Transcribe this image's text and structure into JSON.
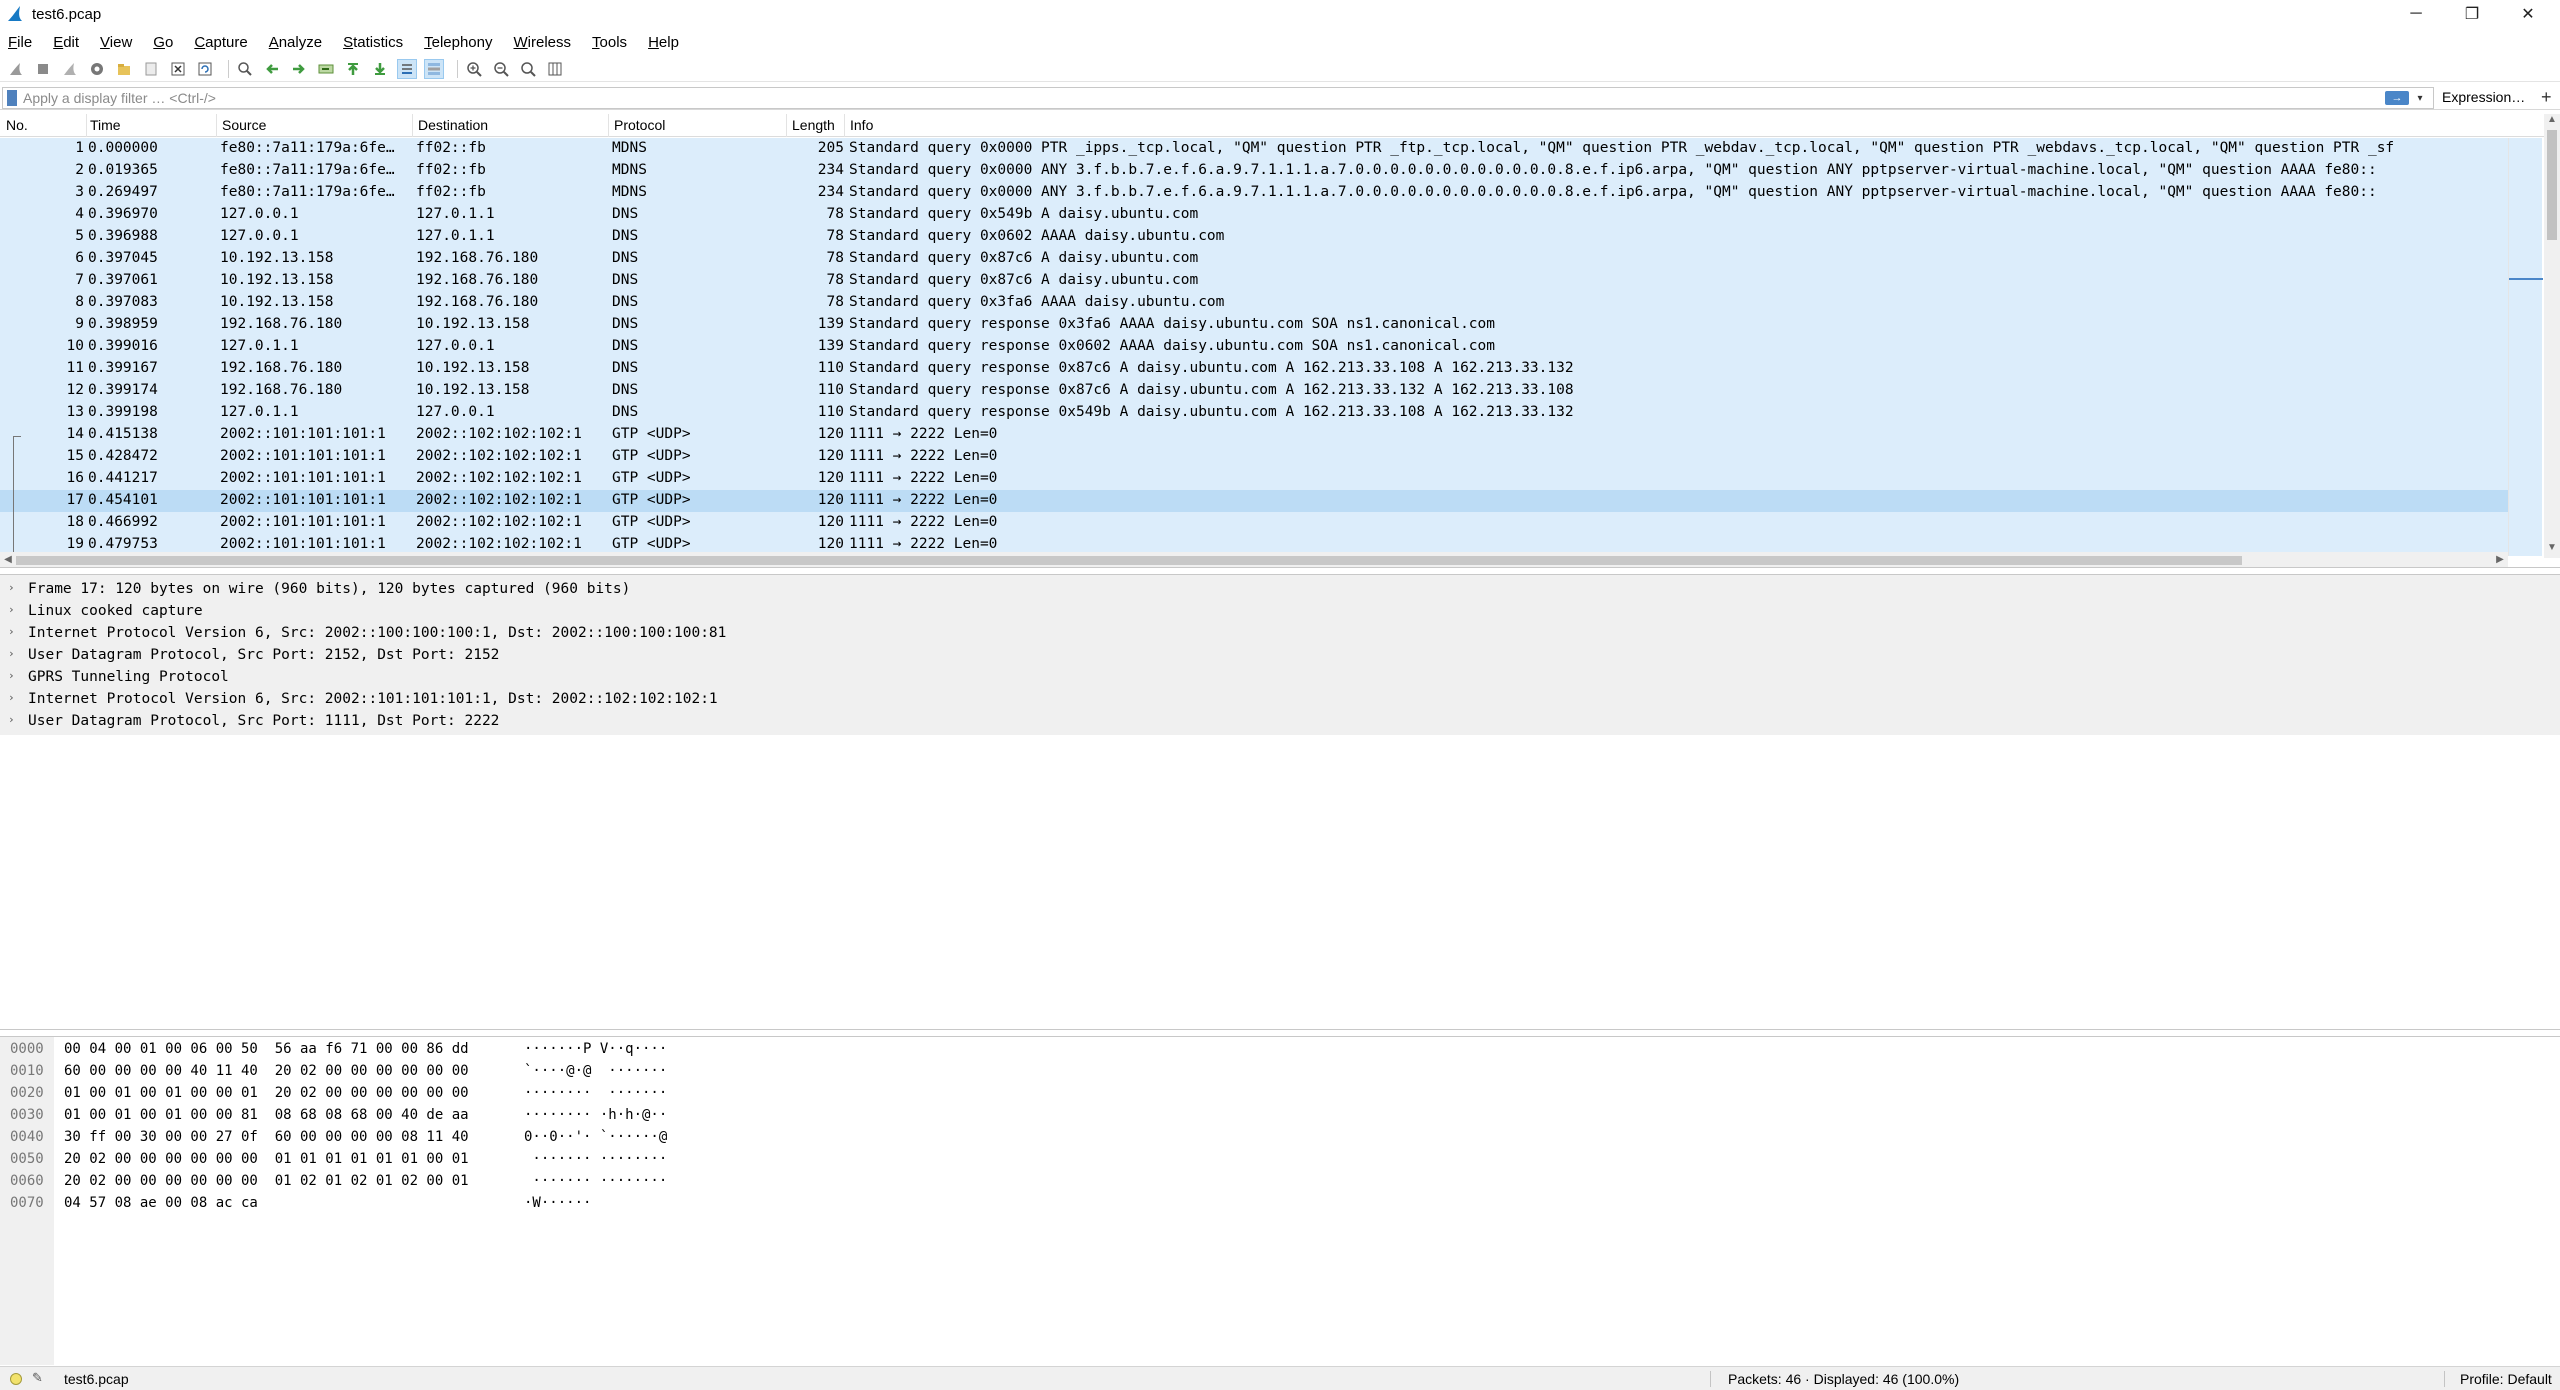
{
  "window": {
    "title": "test6.pcap",
    "controls": [
      "─",
      "❐",
      "✕"
    ]
  },
  "menu": [
    "File",
    "Edit",
    "View",
    "Go",
    "Capture",
    "Analyze",
    "Statistics",
    "Telephony",
    "Wireless",
    "Tools",
    "Help"
  ],
  "filter": {
    "placeholder": "Apply a display filter … <Ctrl-/>",
    "expression_label": "Expression…",
    "plus_label": "+"
  },
  "columns": {
    "no": "No.",
    "time": "Time",
    "source": "Source",
    "destination": "Destination",
    "protocol": "Protocol",
    "length": "Length",
    "info": "Info"
  },
  "packets": [
    {
      "no": "1",
      "time": "0.000000",
      "src": "fe80::7a11:179a:6fe…",
      "dst": "ff02::fb",
      "proto": "MDNS",
      "len": "205",
      "info": "Standard query 0x0000 PTR _ipps._tcp.local, \"QM\" question PTR _ftp._tcp.local, \"QM\" question PTR _webdav._tcp.local, \"QM\" question PTR _webdavs._tcp.local, \"QM\" question PTR _sf"
    },
    {
      "no": "2",
      "time": "0.019365",
      "src": "fe80::7a11:179a:6fe…",
      "dst": "ff02::fb",
      "proto": "MDNS",
      "len": "234",
      "info": "Standard query 0x0000 ANY 3.f.b.b.7.e.f.6.a.9.7.1.1.1.a.7.0.0.0.0.0.0.0.0.0.0.0.0.8.e.f.ip6.arpa, \"QM\" question ANY pptpserver-virtual-machine.local, \"QM\" question AAAA fe80::"
    },
    {
      "no": "3",
      "time": "0.269497",
      "src": "fe80::7a11:179a:6fe…",
      "dst": "ff02::fb",
      "proto": "MDNS",
      "len": "234",
      "info": "Standard query 0x0000 ANY 3.f.b.b.7.e.f.6.a.9.7.1.1.1.a.7.0.0.0.0.0.0.0.0.0.0.0.0.8.e.f.ip6.arpa, \"QM\" question ANY pptpserver-virtual-machine.local, \"QM\" question AAAA fe80::"
    },
    {
      "no": "4",
      "time": "0.396970",
      "src": "127.0.0.1",
      "dst": "127.0.1.1",
      "proto": "DNS",
      "len": "78",
      "info": "Standard query 0x549b A daisy.ubuntu.com"
    },
    {
      "no": "5",
      "time": "0.396988",
      "src": "127.0.0.1",
      "dst": "127.0.1.1",
      "proto": "DNS",
      "len": "78",
      "info": "Standard query 0x0602 AAAA daisy.ubuntu.com"
    },
    {
      "no": "6",
      "time": "0.397045",
      "src": "10.192.13.158",
      "dst": "192.168.76.180",
      "proto": "DNS",
      "len": "78",
      "info": "Standard query 0x87c6 A daisy.ubuntu.com"
    },
    {
      "no": "7",
      "time": "0.397061",
      "src": "10.192.13.158",
      "dst": "192.168.76.180",
      "proto": "DNS",
      "len": "78",
      "info": "Standard query 0x87c6 A daisy.ubuntu.com"
    },
    {
      "no": "8",
      "time": "0.397083",
      "src": "10.192.13.158",
      "dst": "192.168.76.180",
      "proto": "DNS",
      "len": "78",
      "info": "Standard query 0x3fa6 AAAA daisy.ubuntu.com"
    },
    {
      "no": "9",
      "time": "0.398959",
      "src": "192.168.76.180",
      "dst": "10.192.13.158",
      "proto": "DNS",
      "len": "139",
      "info": "Standard query response 0x3fa6 AAAA daisy.ubuntu.com SOA ns1.canonical.com"
    },
    {
      "no": "10",
      "time": "0.399016",
      "src": "127.0.1.1",
      "dst": "127.0.0.1",
      "proto": "DNS",
      "len": "139",
      "info": "Standard query response 0x0602 AAAA daisy.ubuntu.com SOA ns1.canonical.com"
    },
    {
      "no": "11",
      "time": "0.399167",
      "src": "192.168.76.180",
      "dst": "10.192.13.158",
      "proto": "DNS",
      "len": "110",
      "info": "Standard query response 0x87c6 A daisy.ubuntu.com A 162.213.33.108 A 162.213.33.132"
    },
    {
      "no": "12",
      "time": "0.399174",
      "src": "192.168.76.180",
      "dst": "10.192.13.158",
      "proto": "DNS",
      "len": "110",
      "info": "Standard query response 0x87c6 A daisy.ubuntu.com A 162.213.33.132 A 162.213.33.108"
    },
    {
      "no": "13",
      "time": "0.399198",
      "src": "127.0.1.1",
      "dst": "127.0.0.1",
      "proto": "DNS",
      "len": "110",
      "info": "Standard query response 0x549b A daisy.ubuntu.com A 162.213.33.108 A 162.213.33.132"
    },
    {
      "no": "14",
      "time": "0.415138",
      "src": "2002::101:101:101:1",
      "dst": "2002::102:102:102:1",
      "proto": "GTP <UDP>",
      "len": "120",
      "info": "1111 → 2222 Len=0"
    },
    {
      "no": "15",
      "time": "0.428472",
      "src": "2002::101:101:101:1",
      "dst": "2002::102:102:102:1",
      "proto": "GTP <UDP>",
      "len": "120",
      "info": "1111 → 2222 Len=0"
    },
    {
      "no": "16",
      "time": "0.441217",
      "src": "2002::101:101:101:1",
      "dst": "2002::102:102:102:1",
      "proto": "GTP <UDP>",
      "len": "120",
      "info": "1111 → 2222 Len=0"
    },
    {
      "no": "17",
      "time": "0.454101",
      "src": "2002::101:101:101:1",
      "dst": "2002::102:102:102:1",
      "proto": "GTP <UDP>",
      "len": "120",
      "info": "1111 → 2222 Len=0"
    },
    {
      "no": "18",
      "time": "0.466992",
      "src": "2002::101:101:101:1",
      "dst": "2002::102:102:102:1",
      "proto": "GTP <UDP>",
      "len": "120",
      "info": "1111 → 2222 Len=0"
    },
    {
      "no": "19",
      "time": "0.479753",
      "src": "2002::101:101:101:1",
      "dst": "2002::102:102:102:1",
      "proto": "GTP <UDP>",
      "len": "120",
      "info": "1111 → 2222 Len=0"
    }
  ],
  "selected_packet": "17",
  "details": [
    "Frame 17: 120 bytes on wire (960 bits), 120 bytes captured (960 bits)",
    "Linux cooked capture",
    "Internet Protocol Version 6, Src: 2002::100:100:100:1, Dst: 2002::100:100:100:81",
    "User Datagram Protocol, Src Port: 2152, Dst Port: 2152",
    "GPRS Tunneling Protocol",
    "Internet Protocol Version 6, Src: 2002::101:101:101:1, Dst: 2002::102:102:102:1",
    "User Datagram Protocol, Src Port: 1111, Dst Port: 2222"
  ],
  "hex": [
    {
      "off": "0000",
      "hex": "00 04 00 01 00 06 00 50  56 aa f6 71 00 00 86 dd",
      "ascii": "·······P V··q····"
    },
    {
      "off": "0010",
      "hex": "60 00 00 00 00 40 11 40  20 02 00 00 00 00 00 00",
      "ascii": "`····@·@  ·······"
    },
    {
      "off": "0020",
      "hex": "01 00 01 00 01 00 00 01  20 02 00 00 00 00 00 00",
      "ascii": "········  ·······"
    },
    {
      "off": "0030",
      "hex": "01 00 01 00 01 00 00 81  08 68 08 68 00 40 de aa",
      "ascii": "········ ·h·h·@··"
    },
    {
      "off": "0040",
      "hex": "30 ff 00 30 00 00 27 0f  60 00 00 00 00 08 11 40",
      "ascii": "0··0··'· `······@"
    },
    {
      "off": "0050",
      "hex": "20 02 00 00 00 00 00 00  01 01 01 01 01 01 00 01",
      "ascii": " ······· ········"
    },
    {
      "off": "0060",
      "hex": "20 02 00 00 00 00 00 00  01 02 01 02 01 02 00 01",
      "ascii": " ······· ········"
    },
    {
      "off": "0070",
      "hex": "04 57 08 ae 00 08 ac ca",
      "ascii": "·W······"
    }
  ],
  "status": {
    "file": "test6.pcap",
    "packets": "Packets: 46 · Displayed: 46 (100.0%)",
    "profile": "Profile: Default"
  },
  "colors": {
    "row_bg": "#dcedfb",
    "row_selected": "#bcdcf5",
    "accent": "#4a86c8"
  }
}
